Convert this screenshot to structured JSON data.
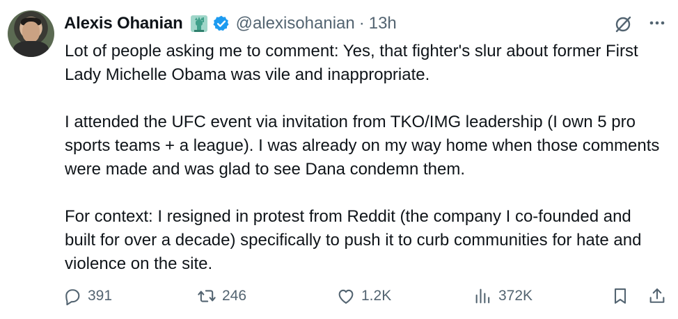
{
  "post": {
    "author_name": "Alexis Ohanian",
    "handle": "@alexisohanian",
    "separator": "·",
    "time": "13h",
    "paragraphs": [
      "Lot of people asking me to comment: Yes, that fighter's slur about former First Lady Michelle Obama was vile and inappropriate.",
      "I attended the UFC event via invitation from TKO/IMG leadership (I own 5 pro sports teams + a league). I was already on my way home when those comments were made and was glad to see Dana condemn them.",
      "For context: I resigned in protest from Reddit (the company I co-founded and built for over a decade) specifically to push it to curb communities for hate and violence on the site."
    ]
  },
  "actions": {
    "replies": "391",
    "reposts": "246",
    "likes": "1.2K",
    "views": "372K"
  },
  "colors": {
    "text": "#0f1419",
    "muted": "#536471",
    "verified": "#1d9bf0",
    "statue": "#3fa08a"
  },
  "icons": [
    "statue-of-liberty-emoji",
    "verified-badge-icon",
    "grok-icon",
    "more-icon",
    "reply-icon",
    "repost-icon",
    "like-icon",
    "views-icon",
    "bookmark-icon",
    "share-icon"
  ]
}
